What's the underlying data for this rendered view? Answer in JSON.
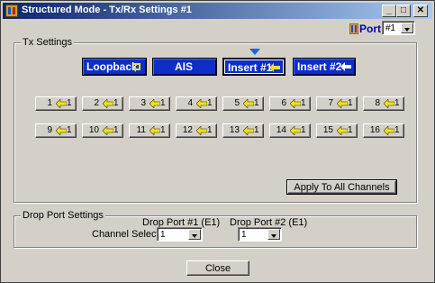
{
  "window": {
    "title": "Structured Mode - Tx/Rx Settings #1",
    "controls": {
      "minimize": "_",
      "maximize": "□",
      "close": "✕"
    }
  },
  "port": {
    "label": "Port",
    "value": "#1"
  },
  "tx_settings": {
    "label": "Tx Settings",
    "modes": [
      {
        "label": "Loopback",
        "icon": "loopback-icon",
        "selected": false
      },
      {
        "label": "AIS",
        "icon": "",
        "selected": false
      },
      {
        "label": "Insert #1",
        "icon": "arrow-left-icon",
        "selected": true
      },
      {
        "label": "Insert #2",
        "icon": "arrow-left-icon",
        "selected": false
      }
    ],
    "channels_row1": [
      {
        "num": "1",
        "target": "1"
      },
      {
        "num": "2",
        "target": "1"
      },
      {
        "num": "3",
        "target": "1"
      },
      {
        "num": "4",
        "target": "1"
      },
      {
        "num": "5",
        "target": "1"
      },
      {
        "num": "6",
        "target": "1"
      },
      {
        "num": "7",
        "target": "1"
      },
      {
        "num": "8",
        "target": "1"
      }
    ],
    "channels_row2": [
      {
        "num": "9",
        "target": "1"
      },
      {
        "num": "10",
        "target": "1"
      },
      {
        "num": "11",
        "target": "1"
      },
      {
        "num": "12",
        "target": "1"
      },
      {
        "num": "13",
        "target": "1"
      },
      {
        "num": "14",
        "target": "1"
      },
      {
        "num": "15",
        "target": "1"
      },
      {
        "num": "16",
        "target": "1"
      }
    ],
    "apply_all": "Apply To All Channels"
  },
  "drop_port": {
    "label": "Drop Port Settings",
    "channel_selection": "Channel Selection",
    "port1_label": "Drop Port #1 (E1)",
    "port1_value": "1",
    "port2_label": "Drop Port #2 (E1)",
    "port2_value": "1"
  },
  "close_label": "Close",
  "colors": {
    "mode_button": "#0d2ec9",
    "arrow": "#f0e020",
    "title_start": "#0a246a"
  }
}
